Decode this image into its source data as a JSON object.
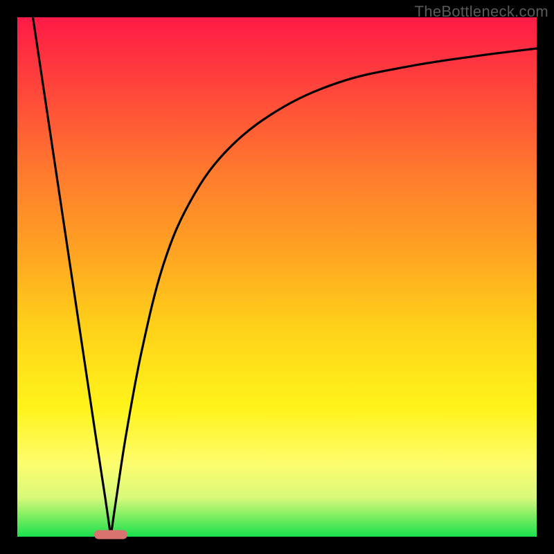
{
  "watermark": "TheBottleneck.com",
  "colors": {
    "frame": "#000000",
    "gradient_top": "#ff1a46",
    "gradient_bottom": "#19e04e",
    "curve": "#000000",
    "marker": "#d8736f",
    "watermark": "#5a5a5a"
  },
  "chart_data": {
    "type": "line",
    "title": "",
    "xlabel": "",
    "ylabel": "",
    "xlim": [
      0,
      100
    ],
    "ylim": [
      0,
      100
    ],
    "grid": false,
    "legend": false,
    "note": "Background is a vertical red→green gradient. Curve is a black V/check-shape: a steep straight descent from the top-left to a valley near x≈18, then a decelerating rise asymptoting near the top toward the right edge. A small rounded pink marker sits at the valley on the baseline.",
    "series": [
      {
        "name": "curve",
        "x": [
          3,
          6,
          9,
          12,
          15,
          17,
          18,
          19,
          21,
          24,
          28,
          33,
          40,
          50,
          62,
          75,
          88,
          100
        ],
        "y": [
          100,
          80,
          60,
          40,
          20,
          7,
          0,
          7,
          20,
          36,
          52,
          64,
          74,
          82,
          87.5,
          90.5,
          92.5,
          94
        ]
      }
    ],
    "marker": {
      "x": 18,
      "y": 0
    }
  }
}
